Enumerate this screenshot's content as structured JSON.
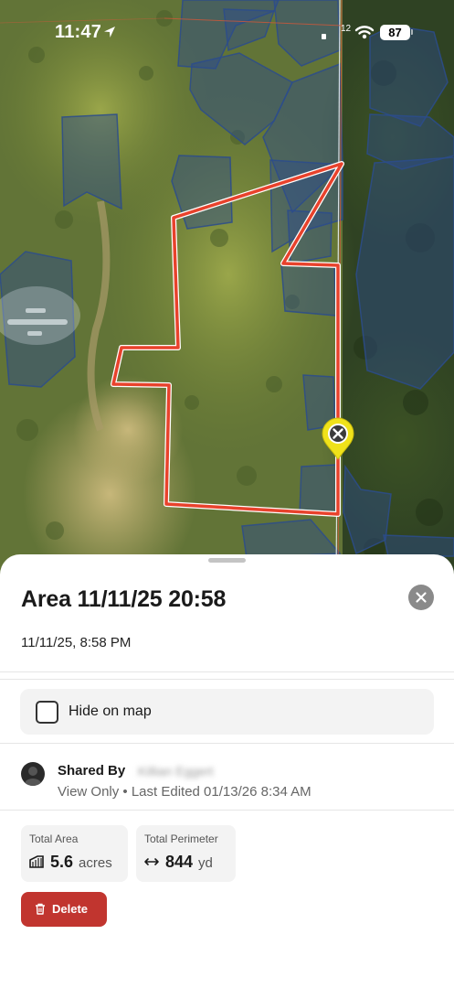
{
  "status_bar": {
    "time": "11:47",
    "signal_label": "12",
    "battery": "87"
  },
  "map": {
    "icons": [
      "location-arrow-icon",
      "wifi-icon",
      "battery-icon",
      "close-pin-icon"
    ],
    "colors": {
      "area_outline": "#e8422c",
      "parcel_overlay": "#2c4c8c",
      "pin": "#f0e21a"
    }
  },
  "sheet": {
    "title": "Area 11/11/25 20:58",
    "subtitle": "11/11/25, 8:58 PM",
    "hide_on_map": {
      "label": "Hide on map",
      "checked": false
    },
    "shared": {
      "label": "Shared By",
      "name": "Killian Eggert",
      "meta": "View Only • Last Edited 01/13/26 8:34 AM"
    },
    "stats": {
      "area": {
        "label": "Total Area",
        "value": "5.6",
        "unit": "acres",
        "icon": "area-icon"
      },
      "perimeter": {
        "label": "Total Perimeter",
        "value": "844",
        "unit": "yd",
        "icon": "perimeter-arrows-icon"
      }
    },
    "delete_label": "Delete",
    "colors": {
      "delete_button": "#c1352f",
      "close_button": "#8a8a8a"
    }
  }
}
